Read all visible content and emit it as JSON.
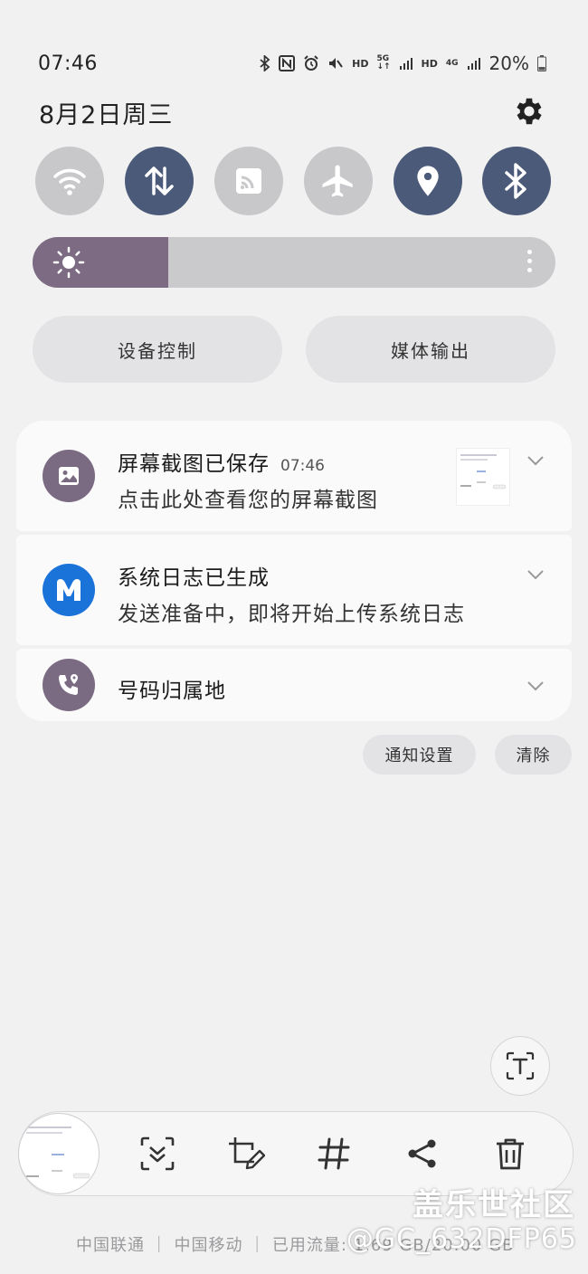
{
  "status_bar": {
    "time": "07:46",
    "hd1": "HD",
    "net1": "5G",
    "hd2": "HD",
    "net2": "4G",
    "battery_percent": "20%"
  },
  "header": {
    "date": "8月2日周三"
  },
  "quick_toggles": [
    {
      "name": "wifi",
      "on": false
    },
    {
      "name": "mobile-data",
      "on": true
    },
    {
      "name": "cast",
      "on": false
    },
    {
      "name": "airplane",
      "on": false
    },
    {
      "name": "location",
      "on": true
    },
    {
      "name": "bluetooth",
      "on": true
    }
  ],
  "brightness": {
    "level_fraction": 0.26
  },
  "pills": {
    "device_control": "设备控制",
    "media_output": "媒体输出"
  },
  "notifications": [
    {
      "title": "屏幕截图已保存",
      "time": "07:46",
      "body": "点击此处查看您的屏幕截图"
    },
    {
      "title": "系统日志已生成",
      "body": "发送准备中，即将开始上传系统日志"
    },
    {
      "title": "号码归属地"
    }
  ],
  "actions": {
    "notification_settings": "通知设置",
    "clear": "清除"
  },
  "footer": {
    "carrier": "中国联通 ｜ 中国移动 ｜ 已用流量: 1.69 GB/20.00 GB",
    "watermark": "盖乐世社区",
    "user_id": "@GC_632DFP65"
  },
  "colors": {
    "accent": "#4b5a78",
    "brightness_fill": "#7d6b83",
    "toggle_off": "#c8c8ca"
  }
}
